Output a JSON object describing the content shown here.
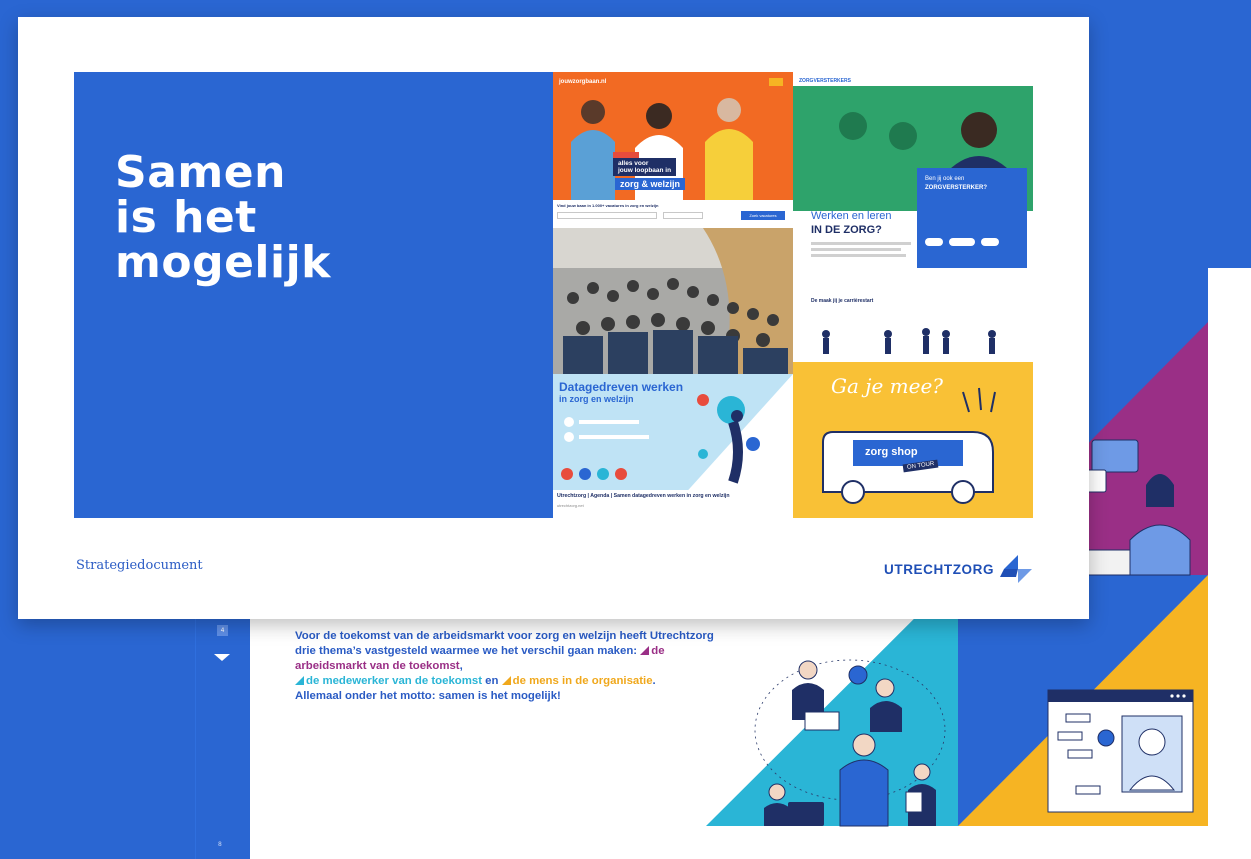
{
  "slide": {
    "title": "Samen\nis het\nmogelijk",
    "footer_label": "Strategiedocument",
    "brand": "UTRECHTZORG"
  },
  "collage": {
    "tile1": {
      "site": "jouwzorgbaan.nl",
      "headline_a": "alles voor",
      "headline_b": "jouw loopbaan in",
      "headline_c": "zorg & welzijn",
      "search_prompt": "Vind jouw baan in 1.000+ vacatures in zorg en welzijn",
      "search_button": "Zoek vacatures"
    },
    "tile3": {
      "title_a": "Datagedreven werken",
      "title_b": "in zorg en welzijn",
      "caption": "Utrechtzorg | Agenda | Samen datagedreven werken in zorg en welzijn",
      "url": "utrechtzorg.net"
    },
    "tile4": {
      "logo": "ZORGVERSTERKERS",
      "heading_a": "Werken en leren",
      "heading_b": "IN DE ZORG?",
      "card_a": "Ben jij ook een",
      "card_b": "ZORGVERSTERKER?",
      "section": "De maak jij je carrièrestart"
    },
    "tile5": {
      "script": "Ga je mee?",
      "van_sign": "zorg shop",
      "van_tag": "ON TOUR"
    }
  },
  "back_page": {
    "page_box": "4",
    "page_bottom": "8",
    "intro_plain": "Voor de toekomst van de arbeidsmarkt voor zorg en welzijn heeft Utrechtzorg drie thema’s vastgesteld waarmee we het verschil gaan maken: ",
    "theme_1": "de arbeidsmarkt van de toekomst",
    "theme_2": "de medewerker van de toekomst",
    "connector": "en",
    "theme_3": "de mens in de organisatie",
    "motto": "Allemaal onder het motto: samen is het mogelijk!"
  },
  "colors": {
    "brand_blue": "#2a66d2",
    "purple": "#9a2f86",
    "cyan": "#2ab5d6",
    "yellow": "#f0a81c"
  }
}
